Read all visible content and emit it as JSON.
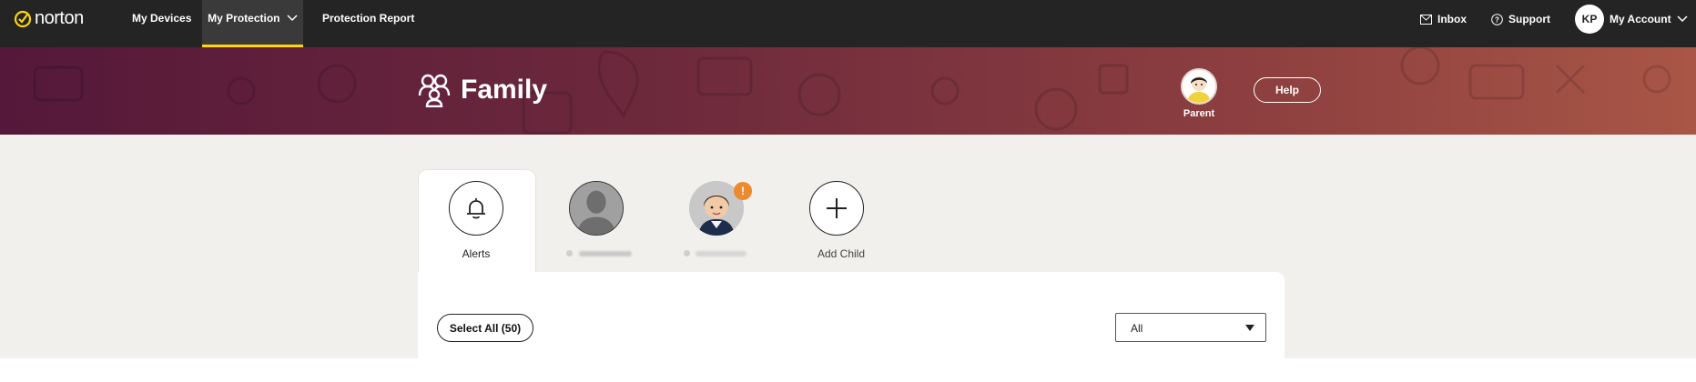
{
  "brand": {
    "name": "norton",
    "accent": "#ffd600"
  },
  "nav": {
    "items": [
      {
        "label": "My Devices"
      },
      {
        "label": "My Protection",
        "active": true
      },
      {
        "label": "Protection Report"
      }
    ],
    "inbox": "Inbox",
    "support": "Support",
    "account_initials": "KP",
    "account": "My Account"
  },
  "banner": {
    "title": "Family",
    "parent_label": "Parent",
    "help": "Help"
  },
  "tabs": {
    "alerts": "Alerts",
    "add_child": "Add Child"
  },
  "toolbar": {
    "select_all": "Select All (50)",
    "filter_value": "All"
  },
  "colors": {
    "topbar": "#242424",
    "banner_start": "#55183a",
    "banner_end": "#a95646",
    "badge": "#ec8a2f",
    "content_bg": "#f2f0ec"
  }
}
